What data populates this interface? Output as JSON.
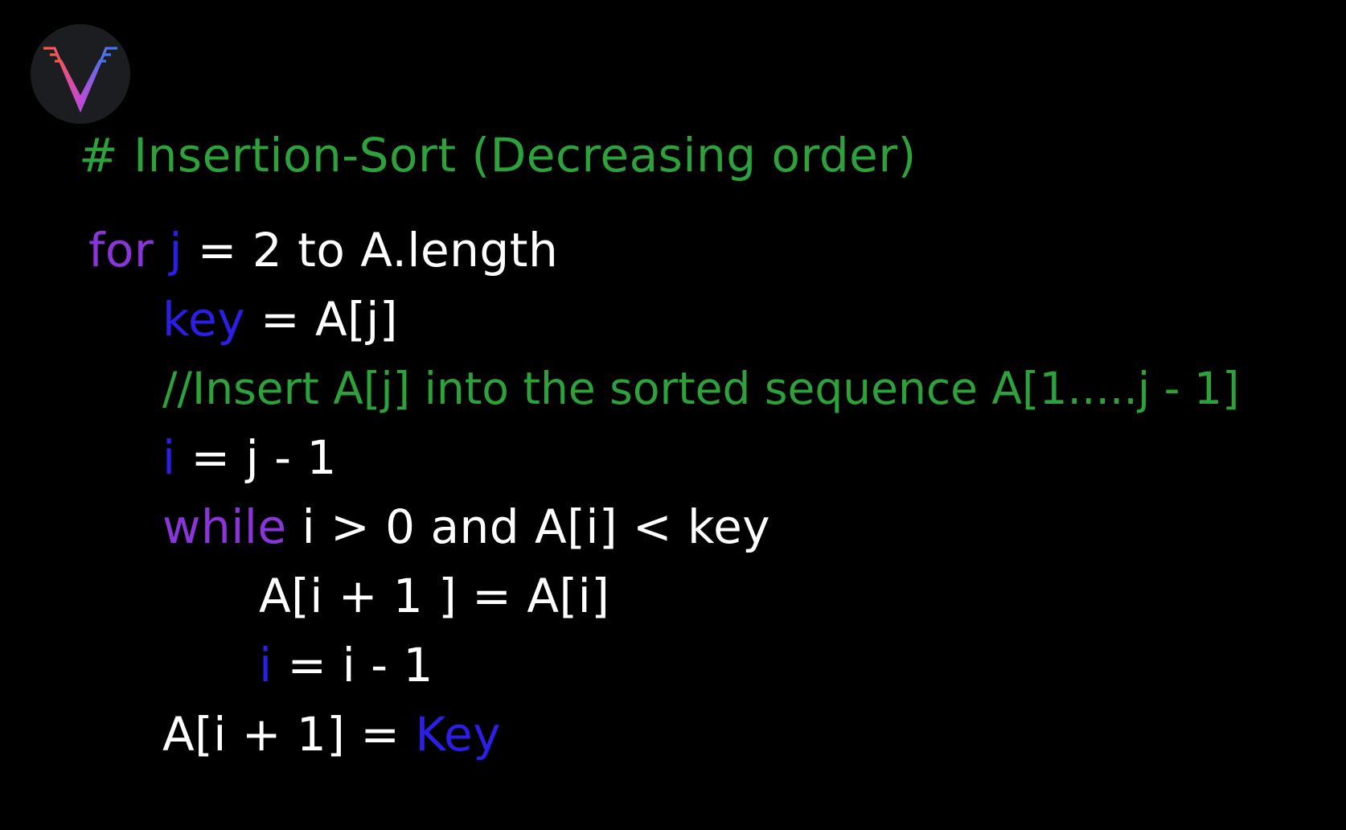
{
  "colors": {
    "background": "#000000",
    "comment": "#2ea23a",
    "keyword": "#8a35d9",
    "variable": "#2b1ee6",
    "text": "#ffffff"
  },
  "logo": {
    "icon": "v-logo-icon",
    "gradient": [
      "#ff5a3c",
      "#c24ad6",
      "#2f7df0"
    ]
  },
  "code": {
    "lines": [
      {
        "indent": 0,
        "tokens": [
          {
            "text": "# Insertion-Sort (Decreasing order)",
            "role": "comment"
          }
        ]
      },
      {
        "indent": 1,
        "tokens": [
          {
            "text": "for ",
            "role": "keyword"
          },
          {
            "text": "j",
            "role": "variable"
          },
          {
            "text": " = 2 to A.length",
            "role": "text"
          }
        ]
      },
      {
        "indent": 2,
        "tokens": [
          {
            "text": "key",
            "role": "variable"
          },
          {
            "text": " = A[j]",
            "role": "text"
          }
        ]
      },
      {
        "indent": 2,
        "tokens": [
          {
            "text": "//Insert A[j] into the sorted sequence A[1.....j - 1]",
            "role": "comment"
          }
        ]
      },
      {
        "indent": 2,
        "tokens": [
          {
            "text": "i",
            "role": "variable"
          },
          {
            "text": " = j - 1",
            "role": "text"
          }
        ]
      },
      {
        "indent": 2,
        "tokens": [
          {
            "text": "while ",
            "role": "keyword"
          },
          {
            "text": "i > 0 and A[i] < key",
            "role": "text"
          }
        ]
      },
      {
        "indent": 3,
        "tokens": [
          {
            "text": "A[i + 1 ] = A[i]",
            "role": "text"
          }
        ]
      },
      {
        "indent": 3,
        "tokens": [
          {
            "text": "i",
            "role": "variable"
          },
          {
            "text": " = i - 1",
            "role": "text"
          }
        ]
      },
      {
        "indent": 2,
        "tokens": [
          {
            "text": "A[i + 1] = ",
            "role": "text"
          },
          {
            "text": "Key",
            "role": "variable"
          }
        ]
      }
    ]
  }
}
